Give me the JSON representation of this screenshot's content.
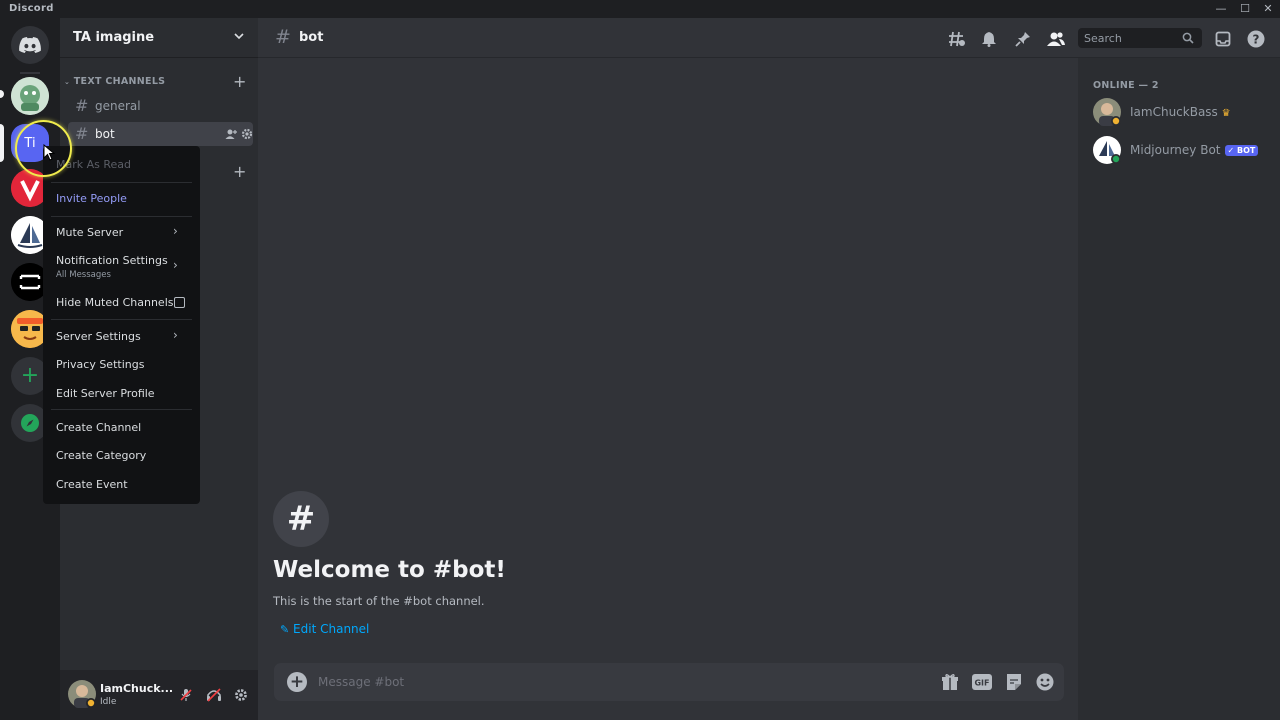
{
  "window": {
    "app_name": "Discord"
  },
  "server": {
    "name": "TA imagine",
    "icon_initials": "Ti"
  },
  "channels": {
    "category": "TEXT CHANNELS",
    "items": [
      {
        "name": "general",
        "active": false
      },
      {
        "name": "bot",
        "active": true
      }
    ]
  },
  "context_menu": {
    "mark_as_read": "Mark As Read",
    "invite": "Invite People",
    "mute": "Mute Server",
    "notifications": "Notification Settings",
    "notifications_sub": "All Messages",
    "hide_muted": "Hide Muted Channels",
    "server_settings": "Server Settings",
    "privacy": "Privacy Settings",
    "edit_profile": "Edit Server Profile",
    "create_channel": "Create Channel",
    "create_category": "Create Category",
    "create_event": "Create Event"
  },
  "chat": {
    "channel": "bot",
    "search_placeholder": "Search",
    "welcome_title": "Welcome to #bot!",
    "welcome_sub": "This is the start of the #bot channel.",
    "edit_channel": "Edit Channel",
    "message_placeholder": "Message #bot"
  },
  "members": {
    "group_label": "ONLINE — 2",
    "list": [
      {
        "name": "IamChuckBass",
        "crown": true
      },
      {
        "name": "Midjourney Bot",
        "badge": "BOT"
      }
    ]
  },
  "user": {
    "name": "IamChuck...",
    "status": "Idle"
  },
  "icons": {
    "home": "discord-logo-icon",
    "add_server": "plus-icon",
    "explore": "compass-icon",
    "threads": "threads-icon",
    "bell": "bell-icon",
    "pin": "pin-icon",
    "members": "members-icon",
    "inbox": "inbox-icon",
    "help": "help-icon",
    "gift": "gift-icon",
    "gif": "gif-icon",
    "sticker": "sticker-icon",
    "emoji": "emoji-icon"
  },
  "colors": {
    "accent": "#5865f2",
    "link": "#00a8fc",
    "online": "#23a55a",
    "idle": "#f0b232",
    "highlight_ring": "#f0ec4d"
  }
}
